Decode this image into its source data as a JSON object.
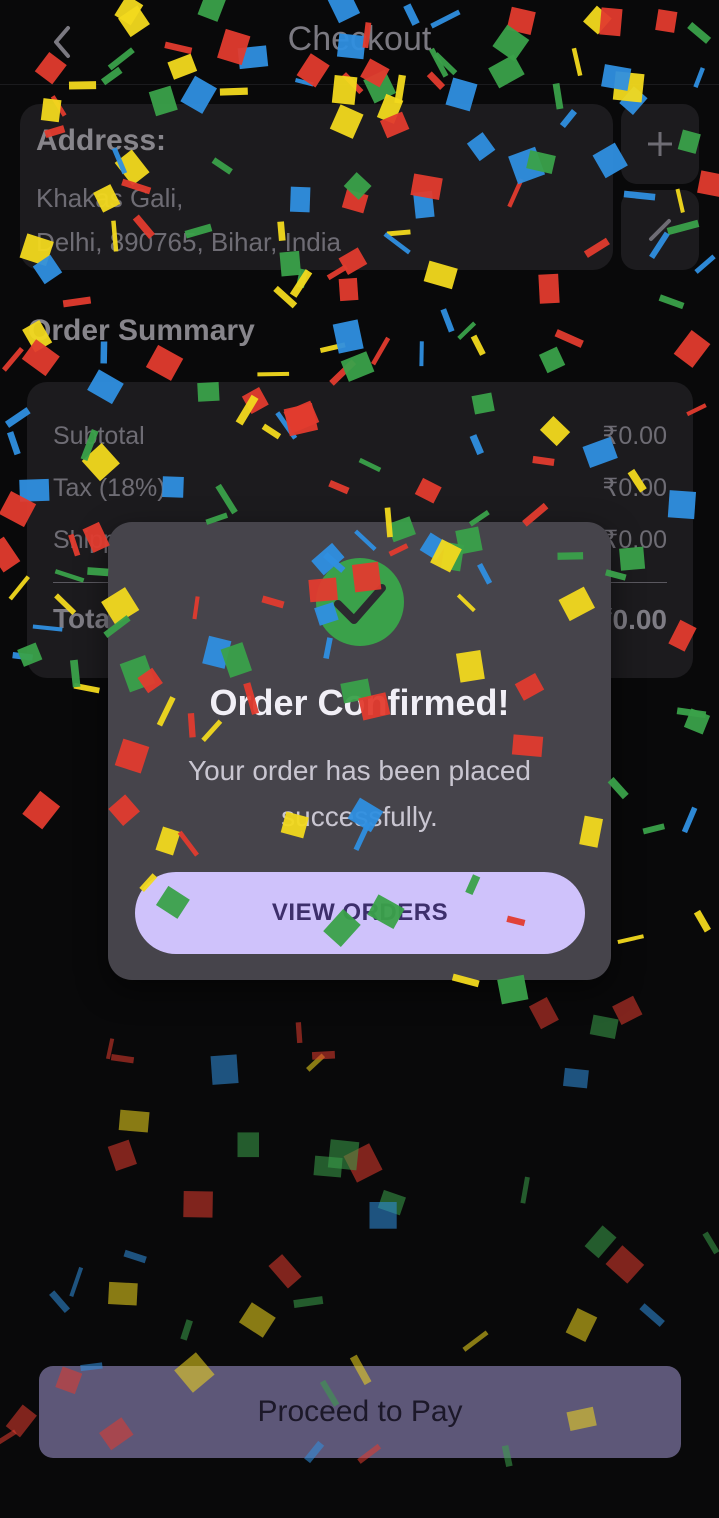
{
  "header": {
    "title": "Checkout",
    "back_icon": "chevron-left-icon"
  },
  "address": {
    "label": "Address:",
    "line1": "Khakas Gali,",
    "line2": "Delhi, 890765, Bihar, India",
    "add_icon": "plus-icon",
    "edit_icon": "pencil-icon"
  },
  "summary": {
    "title": "Order Summary",
    "rows": [
      {
        "label": "Subtotal",
        "value": "₹0.00"
      },
      {
        "label": "Tax (18%)",
        "value": "₹0.00"
      },
      {
        "label": "Shipping",
        "value": "₹0.00"
      }
    ],
    "total": {
      "label": "Total",
      "value": "₹0.00"
    }
  },
  "dialog": {
    "icon": "check-circle-icon",
    "title": "Order Confirmed!",
    "message": "Your order has been placed successfully.",
    "button_label": "VIEW ORDERS"
  },
  "footer": {
    "pay_label": "Proceed to Pay"
  },
  "colors": {
    "background": "#0f0f10",
    "card": "#2b2a2f",
    "dialog": "#46444b",
    "accent": "#cfc2fb",
    "success": "#3aa14a",
    "pay_button": "#8f86b8"
  }
}
